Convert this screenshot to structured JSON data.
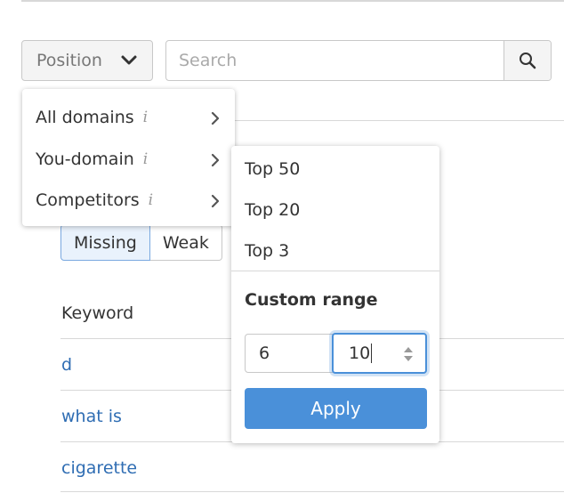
{
  "toolbar": {
    "position_label": "Position",
    "search_placeholder": "Search"
  },
  "tabs": {
    "missing": "Missing",
    "weak": "Weak"
  },
  "table": {
    "header": "Keyword",
    "rows": [
      "d",
      "what is",
      "cigarette"
    ]
  },
  "position_menu": {
    "items": [
      {
        "label": "All domains",
        "info": "i"
      },
      {
        "label": "You-domain",
        "info": "i"
      },
      {
        "label": "Competitors",
        "info": "i"
      }
    ]
  },
  "submenu": {
    "options": [
      "Top 50",
      "Top 20",
      "Top 3"
    ],
    "custom_title": "Custom range",
    "range_from": "6",
    "range_to": "10",
    "apply_label": "Apply"
  },
  "colors": {
    "accent": "#4a90d9",
    "link": "#2f6db3"
  }
}
